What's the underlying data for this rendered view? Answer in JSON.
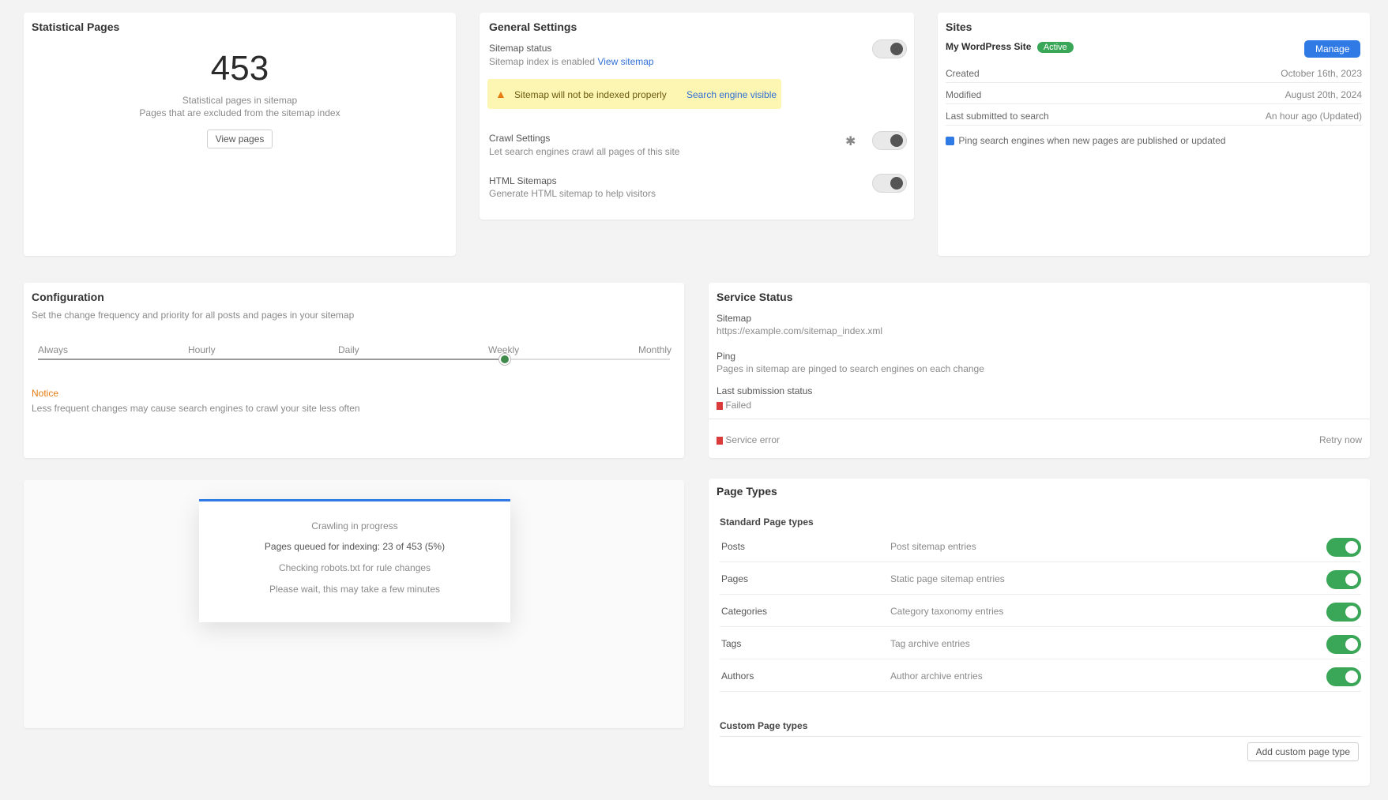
{
  "statistics": {
    "title": "Statistical Pages",
    "count": "453",
    "desc1": "Statistical pages in sitemap",
    "desc2": "Pages that are excluded from the sitemap index",
    "view_button": "View pages"
  },
  "general": {
    "title": "General Settings",
    "sitemap_status_label": "Sitemap status",
    "sitemap_status_sub": "Sitemap index is enabled",
    "sitemap_link": "View sitemap",
    "warning_text": "Sitemap will not be indexed properly",
    "warning_link": "Search engine visible",
    "crawl_label": "Crawl Settings",
    "crawl_sub": "Let search engines crawl all pages of this site",
    "news_label": "HTML Sitemaps",
    "news_sub": "Generate HTML sitemap to help visitors",
    "info_icon": "info-icon",
    "colors": {
      "warning_bg": "#fdf6b2",
      "warning_icon": "#e57c12"
    }
  },
  "sites": {
    "title": "Sites",
    "site_name": "My WordPress Site",
    "site_badge": "Active",
    "site_button": "Manage",
    "rows": [
      {
        "label": "Created",
        "value": "October 16th, 2023"
      },
      {
        "label": "Modified",
        "value": "August 20th, 2024"
      },
      {
        "label": "Last submitted to search",
        "value": "An hour ago (Updated)"
      }
    ],
    "checkbox_label": "Ping search engines when new pages are published or updated"
  },
  "configuration": {
    "title": "Configuration",
    "subtitle": "Set the change frequency and priority for all posts and pages in your sitemap",
    "steps": [
      "Always",
      "Hourly",
      "Daily",
      "Weekly",
      "Monthly"
    ],
    "active_step": "Weekly",
    "notice_label": "Notice",
    "notice_text": "Less frequent changes may cause search engines to crawl your site less often"
  },
  "crawl_popup": {
    "title": "Crawling in progress",
    "line1": "Pages queued for indexing: 23 of 453 (5%)",
    "line2": "Checking robots.txt for rule changes",
    "line3": "Please wait, this may take a few minutes"
  },
  "service": {
    "title": "Service Status",
    "rows": [
      {
        "label": "Sitemap",
        "value": "https://example.com/sitemap_index.xml"
      },
      {
        "label": "Ping",
        "value": "Pages in sitemap are pinged to search engines on each change"
      },
      {
        "label": "Last submission status",
        "value": "Failed"
      }
    ],
    "footer_left": "Service error",
    "footer_right": "Retry now",
    "error_color": "#d93a3a"
  },
  "page_types": {
    "title": "Page Types",
    "standard_heading": "Standard Page types",
    "items": [
      {
        "name": "Posts",
        "desc": "Post sitemap entries"
      },
      {
        "name": "Pages",
        "desc": "Static page sitemap entries"
      },
      {
        "name": "Categories",
        "desc": "Category taxonomy entries"
      },
      {
        "name": "Tags",
        "desc": "Tag archive entries"
      },
      {
        "name": "Authors",
        "desc": "Author archive entries"
      }
    ],
    "custom_heading": "Custom Page types",
    "custom_button": "Add custom page type",
    "toggle_color": "#3aa657"
  }
}
